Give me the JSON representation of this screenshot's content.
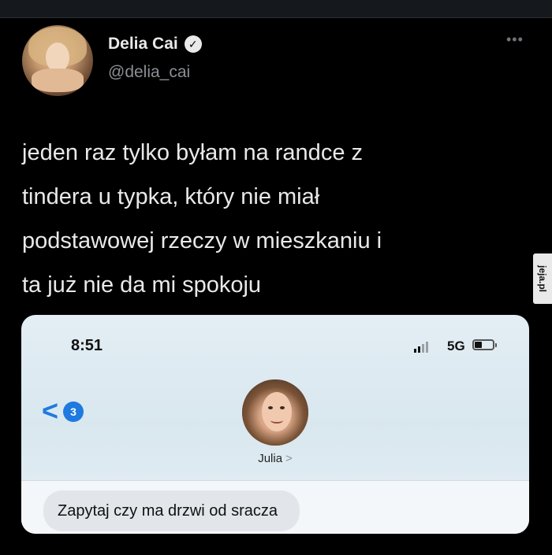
{
  "tweet": {
    "author": {
      "display_name": "Delia Cai",
      "handle": "@delia_cai",
      "verified_glyph": "✓"
    },
    "more_label": "•••",
    "text_lines": [
      "jeden raz tylko byłam na randce z",
      "tindera u typka, który nie miał",
      "podstawowej rzeczy w mieszkaniu i",
      "ta już nie da mi spokoju"
    ]
  },
  "watermark": {
    "text": "jeja.pl"
  },
  "screenshot": {
    "status_bar": {
      "time": "8:51",
      "network": "5G",
      "signal_bars_active": 2,
      "signal_bars_total": 4
    },
    "back": {
      "chevron": "<",
      "unread_count": "3"
    },
    "contact": {
      "name": "Julia",
      "chevron": ">"
    },
    "message": {
      "text": "Zapytaj czy ma drzwi od sracza"
    }
  },
  "colors": {
    "background": "#000000",
    "text_primary": "#e9e9e9",
    "text_secondary": "#8b8f93",
    "ios_blue": "#1f7ae0",
    "bubble": "#e2e6ea"
  },
  "icons": [
    "verified-badge-icon",
    "more-options-icon",
    "signal-icon",
    "battery-icon",
    "back-chevron-icon",
    "contact-chevron-icon"
  ]
}
